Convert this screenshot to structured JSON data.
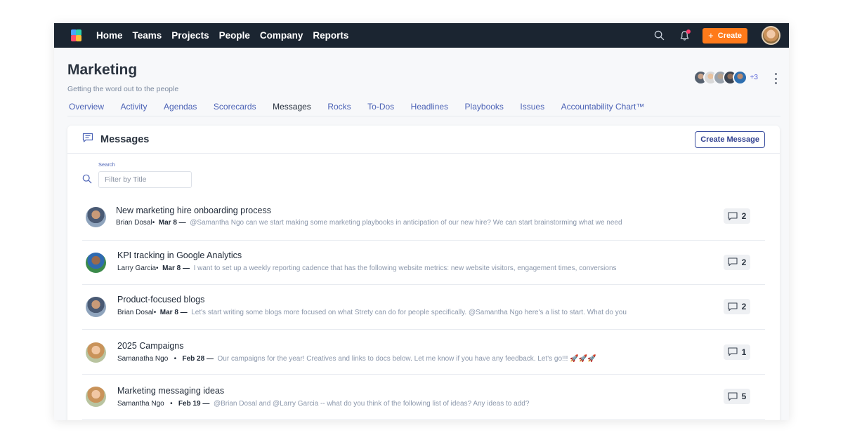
{
  "topnav": {
    "links": [
      "Home",
      "Teams",
      "Projects",
      "People",
      "Company",
      "Reports"
    ],
    "create_label": "Create",
    "plus": "+"
  },
  "header": {
    "title": "Marketing",
    "subtitle": "Getting the word out to the people",
    "more_members": "+3"
  },
  "tabs": [
    "Overview",
    "Activity",
    "Agendas",
    "Scorecards",
    "Messages",
    "Rocks",
    "To-Dos",
    "Headlines",
    "Playbooks",
    "Issues",
    "Accountability Chart™"
  ],
  "active_tab": "Messages",
  "card": {
    "title": "Messages",
    "create_button": "Create Message",
    "search_label": "Search",
    "search_placeholder": "Filter by Title"
  },
  "messages": [
    {
      "title": "New marketing hire onboarding process",
      "author": "Brian Dosal",
      "sep": "•",
      "date": "Mar 8 —",
      "preview": "@Samantha Ngo can we start making some marketing playbooks in anticipation of our new hire? We can start brainstorming what we need",
      "comments": "2",
      "avatar": "brian"
    },
    {
      "title": "KPI tracking in Google Analytics",
      "author": "Larry Garcia",
      "sep": "•",
      "date": "Mar 8 —",
      "preview": "I want to set up a weekly reporting cadence that has the following website metrics: new website visitors, engagement times, conversions",
      "comments": "2",
      "avatar": "larry"
    },
    {
      "title": "Product-focused blogs",
      "author": "Brian Dosal",
      "sep": "•",
      "date": "Mar 8 —",
      "preview": "Let's start writing some blogs more focused on what Strety can do for people specifically. @Samantha Ngo here's a list to start. What do you",
      "comments": "2",
      "avatar": "brian"
    },
    {
      "title": "2025 Campaigns",
      "author": "Samanatha Ngo",
      "sep": "•",
      "date": "Feb 28 —",
      "preview": "Our campaigns for the year! Creatives and links to docs below. Let me know if you have any feedback. Let's go!!! 🚀🚀🚀",
      "comments": "1",
      "avatar": "sam"
    },
    {
      "title": "Marketing messaging ideas",
      "author": "Samantha Ngo",
      "sep": "•",
      "date": "Feb 19 —",
      "preview": "@Brian Dosal and @Larry Garcia -- what do you think of the following list of ideas? Any ideas to add?",
      "comments": "5",
      "avatar": "sam"
    }
  ],
  "colors": {
    "topnav_bg": "#1b2531",
    "create_button": "#ff7a1a",
    "tab_link": "#4c63b6",
    "preview_text": "#8b97ab"
  },
  "icons": {
    "search": "search-icon",
    "bell": "bell-icon",
    "messages": "chat-lines-icon",
    "comment": "comment-icon",
    "more": "kebab-menu-icon"
  }
}
